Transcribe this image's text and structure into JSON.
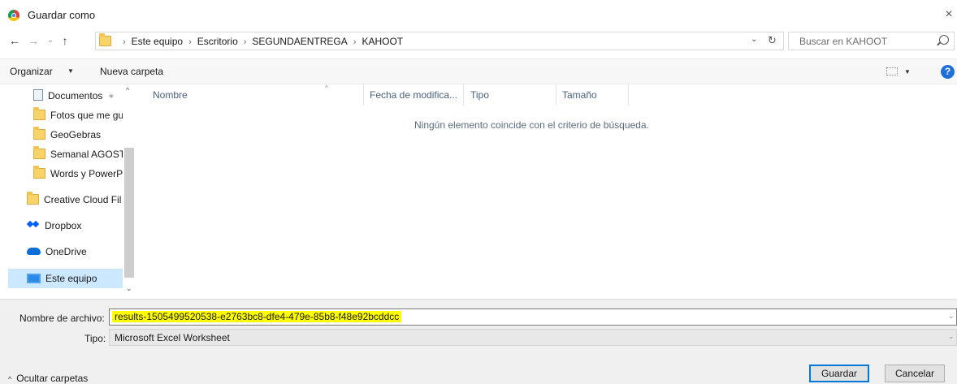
{
  "window": {
    "title": "Guardar como",
    "close_glyph": "×",
    "icon": "chrome-icon"
  },
  "nav": {
    "back_glyph": "←",
    "forward_glyph": "→",
    "recent_glyph": "⌄",
    "up_glyph": "↑",
    "breadcrumbs": [
      "Este equipo",
      "Escritorio",
      "SEGUNDAENTREGA",
      "KAHOOT"
    ],
    "breadcrumb_sep": "›",
    "dropdown_glyph": "⌄",
    "refresh_glyph": "↻",
    "search_placeholder": "Buscar en KAHOOT"
  },
  "toolbar": {
    "organize_label": "Organizar",
    "organize_chev": "▼",
    "new_folder_label": "Nueva carpeta",
    "view_chev": "▼",
    "help_glyph": "?"
  },
  "sidebar": {
    "items": [
      {
        "label": "Documentos",
        "pin": "✶",
        "icon": "document-icon"
      },
      {
        "label": "Fotos que me gu",
        "icon": "folder-icon"
      },
      {
        "label": "GeoGebras",
        "icon": "folder-icon"
      },
      {
        "label": "Semanal AGOST",
        "icon": "folder-icon"
      },
      {
        "label": "Words y PowerP",
        "icon": "folder-icon"
      },
      {
        "label": "Creative Cloud Fil",
        "icon": "folder-icon"
      },
      {
        "label": "Dropbox",
        "icon": "dropbox-icon"
      },
      {
        "label": "OneDrive",
        "icon": "onedrive-icon"
      },
      {
        "label": "Este equipo",
        "icon": "computer-icon",
        "selected": true
      }
    ],
    "scroll_up": "^",
    "scroll_down": "⌄"
  },
  "file_list": {
    "columns": [
      "Nombre",
      "Fecha de modifica...",
      "Tipo",
      "Tamaño"
    ],
    "sort_caret": "^",
    "empty_message": "Ningún elemento coincide con el criterio de búsqueda."
  },
  "form": {
    "filename_label": "Nombre de archivo:",
    "filename_value": "results-1505499520538-e2763bc8-dfe4-479e-85b8-f48e92bcddcc",
    "type_label": "Tipo:",
    "type_value": "Microsoft Excel Worksheet",
    "dropdown_chev": "⌄"
  },
  "footer": {
    "hide_folders_caret": "^",
    "hide_folders_label": "Ocultar carpetas",
    "save_label": "Guardar",
    "cancel_label": "Cancelar"
  },
  "colors": {
    "selection": "#cce8ff",
    "highlight": "#ffff00",
    "accent": "#0078d7"
  }
}
